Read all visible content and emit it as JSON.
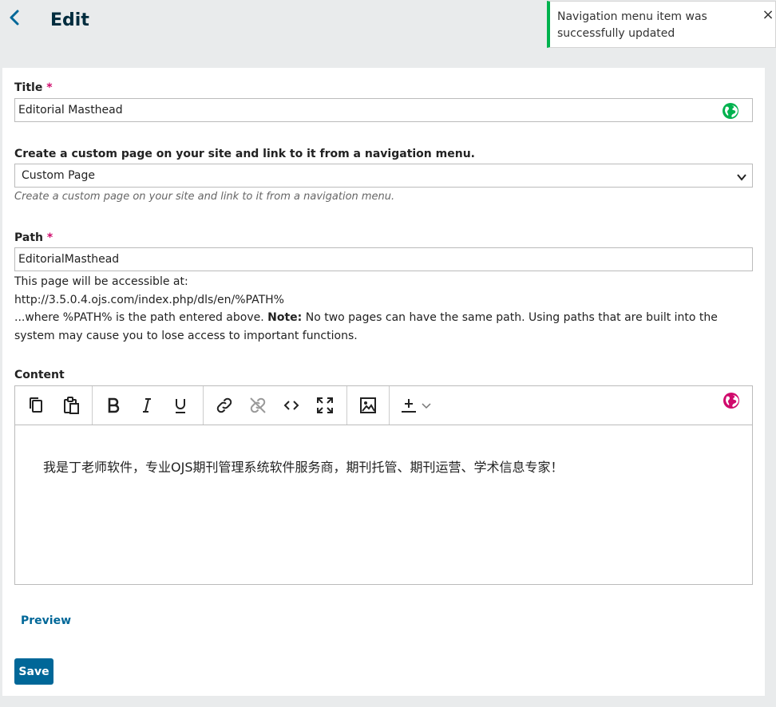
{
  "header": {
    "title": "Edit"
  },
  "notification": {
    "message": "Navigation menu item was successfully updated",
    "close_symbol": "×"
  },
  "form": {
    "title_field": {
      "label": "Title",
      "required_mark": "*",
      "value": "Editorial Masthead"
    },
    "type_field": {
      "label": "Create a custom page on your site and link to it from a navigation menu.",
      "selected": "Custom Page",
      "help": "Create a custom page on your site and link to it from a navigation menu."
    },
    "path_field": {
      "label": "Path",
      "required_mark": "*",
      "value": "EditorialMasthead",
      "description_line1": "This page will be accessible at:",
      "description_url": "http://3.5.0.4.ojs.com/index.php/dls/en/%PATH%",
      "description_where": "...where %PATH% is the path entered above.",
      "note_label": "Note:",
      "note_text": "No two pages can have the same path. Using paths that are built into the system may cause you to lose access to important functions."
    },
    "content_field": {
      "label": "Content",
      "body_text": "我是丁老师软件，专业OJS期刊管理系统软件服务商，期刊托管、期刊运营、学术信息专家！"
    },
    "preview_label": "Preview",
    "save_label": "Save"
  },
  "icons": {
    "back": "chevron-left-icon",
    "close": "close-icon",
    "globe": "globe-icon",
    "toolbar": [
      "copy-icon",
      "paste-icon",
      "bold-icon",
      "italic-icon",
      "underline-icon",
      "link-icon",
      "unlink-icon",
      "code-icon",
      "fullscreen-icon",
      "image-icon",
      "upload-icon",
      "chevron-down-icon"
    ]
  },
  "colors": {
    "accent": "#006798",
    "success": "#00b24e",
    "required": "#d00a6c",
    "title_globe": "#00b24e",
    "content_globe": "#d00a6c"
  }
}
